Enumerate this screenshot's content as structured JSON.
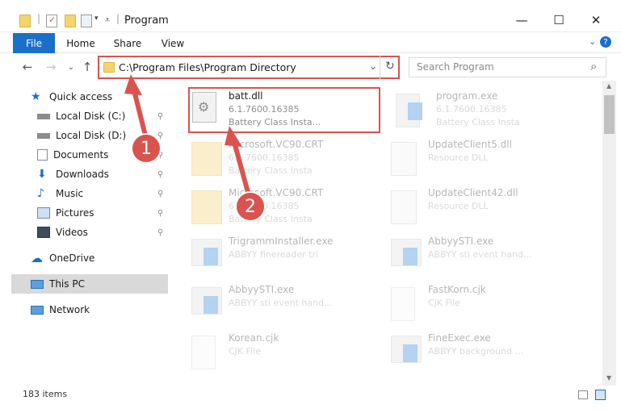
{
  "window": {
    "title": "Program",
    "minimize": "—",
    "maximize": "☐",
    "close": "✕"
  },
  "ribbon": {
    "tabs": [
      "File",
      "Home",
      "Share",
      "View"
    ],
    "help": "?",
    "expand": "⌄"
  },
  "nav": {
    "back": "←",
    "forward": "→",
    "recent": "⌄",
    "up": "↑",
    "address": "C:\\Program Files\\Program Directory",
    "address_chevron": "⌄",
    "refresh": "↻",
    "search_placeholder": "Search Program",
    "search_icon_glyph": "⌕"
  },
  "sidebar": {
    "items": [
      {
        "label": "Quick access",
        "icon": "star-icon"
      },
      {
        "label": "Local Disk (C:)",
        "icon": "drive-icon"
      },
      {
        "label": "Local Disk (D:)",
        "icon": "drive-icon"
      },
      {
        "label": "Documents",
        "icon": "documents-icon"
      },
      {
        "label": "Downloads",
        "icon": "download-icon"
      },
      {
        "label": "Music",
        "icon": "music-icon"
      },
      {
        "label": "Pictures",
        "icon": "pictures-icon"
      },
      {
        "label": "Videos",
        "icon": "videos-icon"
      },
      {
        "label": "OneDrive",
        "icon": "cloud-icon"
      },
      {
        "label": "This PC",
        "icon": "computer-icon"
      },
      {
        "label": "Network",
        "icon": "network-icon"
      }
    ],
    "pin_glyph": "📌"
  },
  "files": [
    {
      "name": "batt.dll",
      "line2": "6.1.7600.16385",
      "line3": "Battery Class Insta...",
      "icon": "dll-file-icon",
      "highlighted": true
    },
    {
      "name": "program.exe",
      "line2": "6.1.7600.16385",
      "line3": "Battery Class Insta",
      "icon": "exe-file-icon"
    },
    {
      "name": "Microsoft.VC90.CRT",
      "line2": "6.1.7600.16385",
      "line3": "Battery Class Insta",
      "icon": "folder-icon"
    },
    {
      "name": "UpdateClient5.dll",
      "line2": "Resource DLL",
      "line3": "",
      "icon": "dll-file-icon"
    },
    {
      "name": "Microsoft.VC90.CRT",
      "line2": "6.1.7600.16385",
      "line3": "Battery Class Insta",
      "icon": "folder-icon"
    },
    {
      "name": "UpdateClient42.dll",
      "line2": "Resource DLL",
      "line3": "",
      "icon": "dll-file-icon"
    },
    {
      "name": "TrigrammInstaller.exe",
      "line2": "ABBYY finereader tri",
      "line3": "",
      "icon": "app-icon"
    },
    {
      "name": "AbbyySTI.exe",
      "line2": "ABBYY sti event hand...",
      "line3": "",
      "icon": "app-icon"
    },
    {
      "name": "AbbyySTI.exe",
      "line2": "ABBYY sti event hand...",
      "line3": "",
      "icon": "app-icon"
    },
    {
      "name": "FastKorn.cjk",
      "line2": "CJK File",
      "line3": "",
      "icon": "file-icon"
    },
    {
      "name": "Korean.cjk",
      "line2": "CJK File",
      "line3": "",
      "icon": "file-icon"
    },
    {
      "name": "FineExec.exe",
      "line2": "ABBYY background ...",
      "line3": "",
      "icon": "app-icon"
    }
  ],
  "status": {
    "count": "183 items"
  },
  "callouts": [
    "1",
    "2"
  ],
  "colors": {
    "accent": "#1a6fc9",
    "highlight": "#d9534f",
    "selected": "#d9d9d9"
  }
}
